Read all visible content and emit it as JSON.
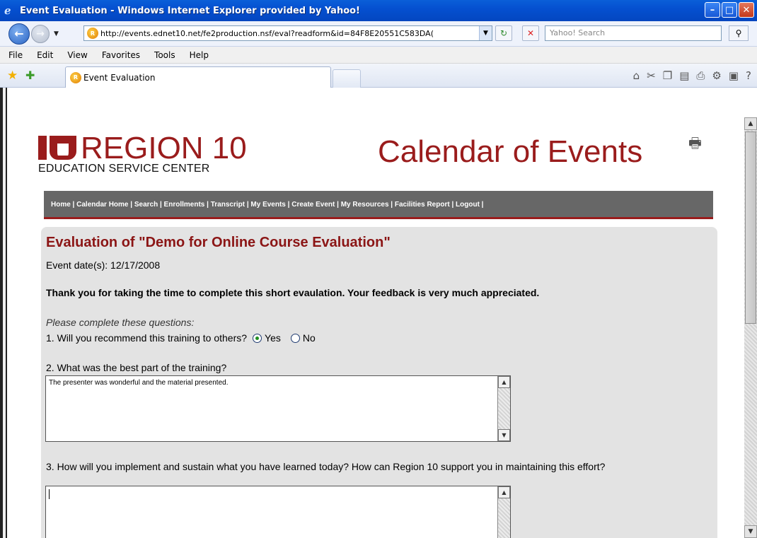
{
  "window": {
    "title": "Event Evaluation - Windows Internet Explorer provided by Yahoo!",
    "minimize": "–",
    "maximize": "□",
    "close": "✕"
  },
  "address": {
    "url": "http://events.ednet10.net/fe2production.nsf/eval?readform&id=84F8E20551C583DA(",
    "search_placeholder": "Yahoo! Search"
  },
  "menu": [
    "File",
    "Edit",
    "View",
    "Favorites",
    "Tools",
    "Help"
  ],
  "tab": {
    "label": "Event Evaluation"
  },
  "header": {
    "logo_title": "REGION 10",
    "logo_subtitle": "EDUCATION SERVICE CENTER",
    "calendar_title": "Calendar of Events"
  },
  "site_nav": {
    "text": "Home | Calendar Home | Search | Enrollments | Transcript | My Events | Create Event | My Resources | Facilities Report | Logout |"
  },
  "evaluation": {
    "title": "Evaluation of \"Demo for Online Course Evaluation\"",
    "event_date": "Event date(s): 12/17/2008",
    "thanks": "Thank you for taking the time to complete this short evaulation. Your feedback is very much appreciated.",
    "instructions": "Please complete these questions:",
    "q1": {
      "label": "1. Will you recommend this training to others?",
      "yes": "Yes",
      "no": "No",
      "selected": "Yes"
    },
    "q2": {
      "label": "2. What was the best part of the training?",
      "answer": "The presenter was wonderful and the material presented."
    },
    "q3": {
      "label": "3. How will you implement and sustain what you have learned today? How can Region 10 support you in maintaining this effort?",
      "answer": ""
    }
  },
  "icons": {
    "ie": "ie-icon",
    "back": "back-arrow-icon",
    "forward": "forward-arrow-icon",
    "site": "site-favicon-icon",
    "refresh": "refresh-icon",
    "stop": "stop-icon",
    "search": "search-icon",
    "favorites": "favorites-star-icon",
    "add_favorite": "add-favorite-icon",
    "home": "home-icon",
    "printer": "printer-icon"
  },
  "colors": {
    "brand_red": "#9a1c1c",
    "title_red": "#8b1515",
    "xp_titlebar": "#0550d0",
    "nav_grey": "#676767",
    "panel_grey": "#e3e3e3"
  }
}
